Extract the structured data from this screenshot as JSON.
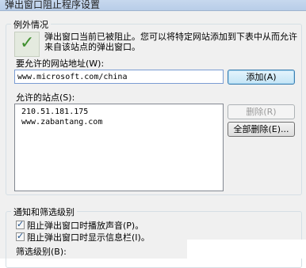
{
  "window": {
    "title": "弹出窗口阻止程序设置"
  },
  "exceptions": {
    "legend": "例外情况",
    "info_text": "弹出窗口当前已被阻止。您可以将特定网站添加到下表中从而允许来自该站点的弹出窗口。",
    "address_label": "要允许的网站地址(W):",
    "address_value": "www.microsoft.com/china",
    "add_button": "添加(A)",
    "allowed_label": "允许的站点(S):",
    "allowed_sites": [
      "210.51.181.175",
      "www.zabantang.com"
    ],
    "remove_button": "删除(R)",
    "remove_all_button": "全部删除(E)..."
  },
  "notifications": {
    "legend": "通知和筛选级别",
    "play_sound_label": "阻止弹出窗口时播放声音(P)。",
    "play_sound_checked": true,
    "show_bar_label": "阻止弹出窗口时显示信息栏(I)。",
    "show_bar_checked": true,
    "filter_level_label": "筛选级别(B):"
  }
}
